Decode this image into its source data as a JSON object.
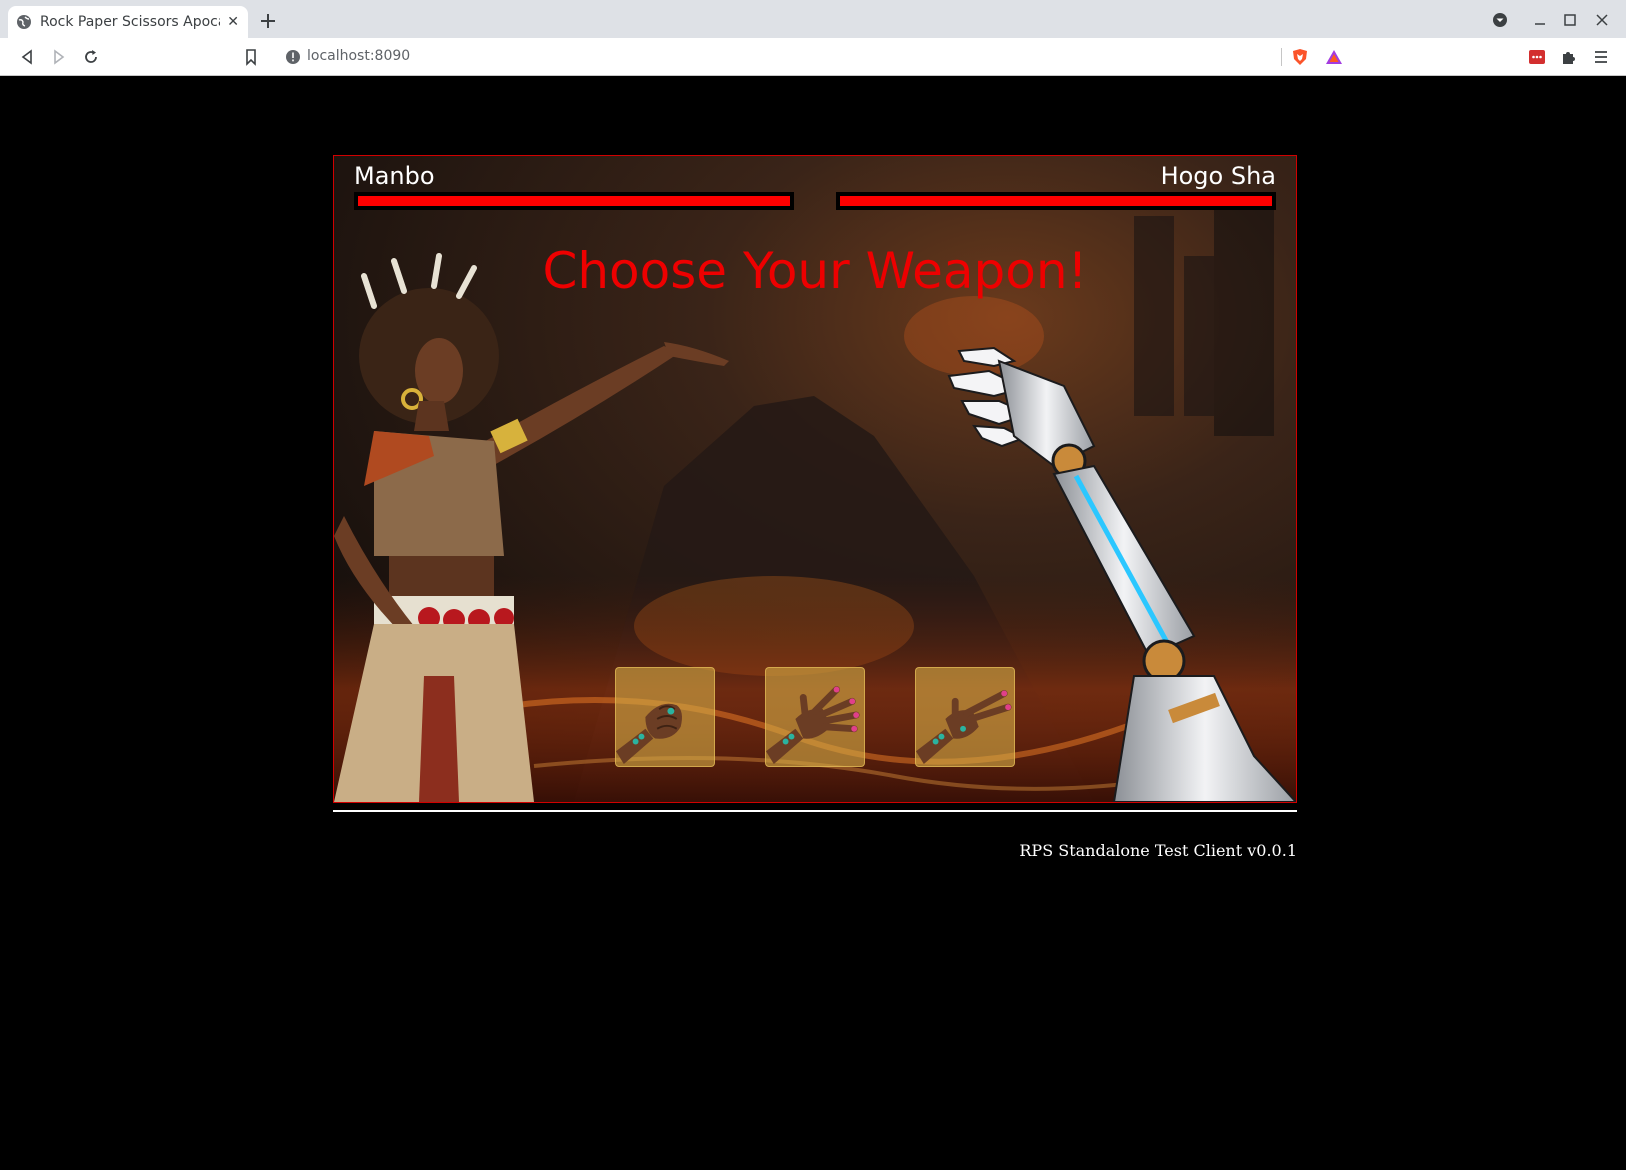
{
  "browser": {
    "tab_title": "Rock Paper Scissors Apocal",
    "url": "localhost:8090"
  },
  "game": {
    "player_left": {
      "name": "Manbo",
      "health_fraction": 1.0
    },
    "player_right": {
      "name": "Hogo Sha",
      "health_fraction": 1.0
    },
    "headline": "Choose Your Weapon!",
    "weapons": [
      {
        "id": "rock",
        "icon": "rock-hand-icon"
      },
      {
        "id": "paper",
        "icon": "paper-hand-icon"
      },
      {
        "id": "scissors",
        "icon": "scissors-hand-icon"
      }
    ],
    "colors": {
      "headline": "#ee0000",
      "health_bar": "#ff0000",
      "frame_border": "#d10000",
      "weapon_tile": "#d4aa46"
    }
  },
  "footer": {
    "version_text": "RPS Standalone Test Client v0.0.1"
  }
}
